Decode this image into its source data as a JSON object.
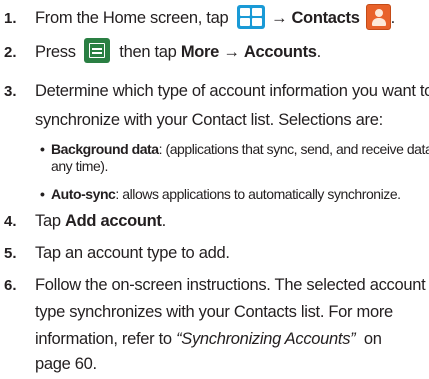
{
  "steps": [
    {
      "num": "1.",
      "parts": {
        "a": "From the Home screen, tap",
        "arrow": "→",
        "b": "Contacts",
        "end": "."
      },
      "icons": [
        "apps-icon",
        "contacts-icon"
      ]
    },
    {
      "num": "2.",
      "parts": {
        "a": "Press",
        "b": "then tap",
        "c": "More",
        "arrow": "→",
        "d": "Accounts",
        "end": "."
      },
      "icons": [
        "menu-icon"
      ]
    },
    {
      "num": "3.",
      "line1": "Determine which type of account information you want to",
      "line2": "synchronize with your Contact list. Selections are:"
    },
    {
      "num": "4.",
      "a": "Tap",
      "b": "Add account",
      "end": "."
    },
    {
      "num": "5.",
      "a": "Tap an account type to add."
    },
    {
      "num": "6.",
      "line1": "Follow the on-screen instructions. The selected account",
      "line2": "type synchronizes with your Contacts list. For more",
      "line3a": "information, refer to",
      "line3ref": "“Synchronizing Accounts”",
      "line3b": "on",
      "line4": "page 60."
    }
  ],
  "bullets": [
    {
      "dot": "•",
      "term": "Background data",
      "rest1": ": (applications that sync, send, and receive data",
      "rest2": "any time)."
    },
    {
      "dot": "•",
      "term": "Auto-sync",
      "rest1": ": allows applications to automatically synchronize."
    }
  ],
  "colors": {
    "text": "#231f20",
    "apps_icon": "#1a9ad6",
    "contacts_icon": "#e8622a",
    "menu_icon": "#2a7f43"
  }
}
